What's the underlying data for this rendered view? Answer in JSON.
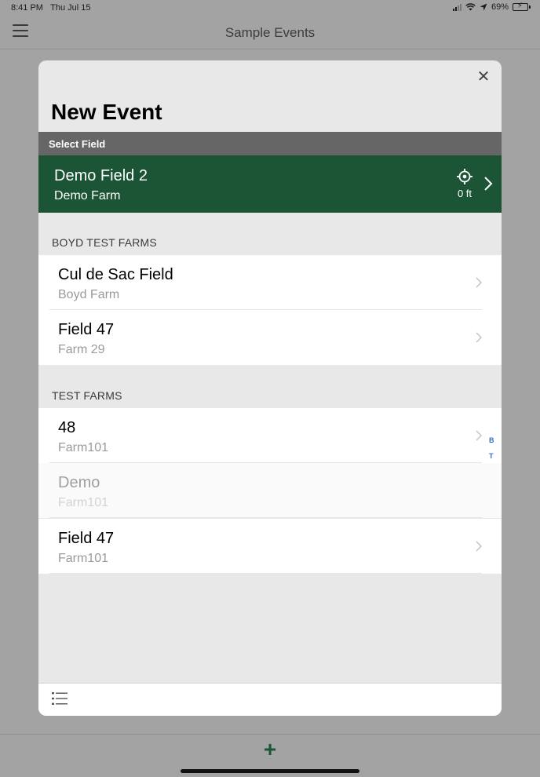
{
  "status_bar": {
    "time": "8:41 PM",
    "date": "Thu Jul 15",
    "battery_percent": "69%",
    "battery_level": 0.69
  },
  "nav": {
    "title": "Sample Events"
  },
  "modal": {
    "title": "New Event",
    "close_label": "✕",
    "section_label": "Select Field",
    "selected_field": {
      "name": "Demo Field 2",
      "farm": "Demo Farm",
      "distance": "0 ft"
    },
    "groups": [
      {
        "header": "BOYD TEST FARMS",
        "rows": [
          {
            "name": "Cul de Sac Field",
            "farm": "Boyd Farm"
          },
          {
            "name": "Field 47",
            "farm": "Farm 29"
          }
        ]
      },
      {
        "header": "TEST FARMS",
        "rows": [
          {
            "name": "48",
            "farm": "Farm101"
          },
          {
            "name": "Demo",
            "farm": "Farm101"
          },
          {
            "name": "Field 47",
            "farm": "Farm101"
          }
        ]
      }
    ],
    "index_letters": [
      "B",
      "T"
    ]
  },
  "bottom": {
    "add_label": "+"
  },
  "colors": {
    "accent_green": "#1b5535",
    "section_gray": "#666666",
    "index_blue": "#2f73c9"
  },
  "icons": [
    "menu-icon",
    "close-icon",
    "location-target-icon",
    "chevron-right-icon",
    "list-icon",
    "plus-icon"
  ]
}
